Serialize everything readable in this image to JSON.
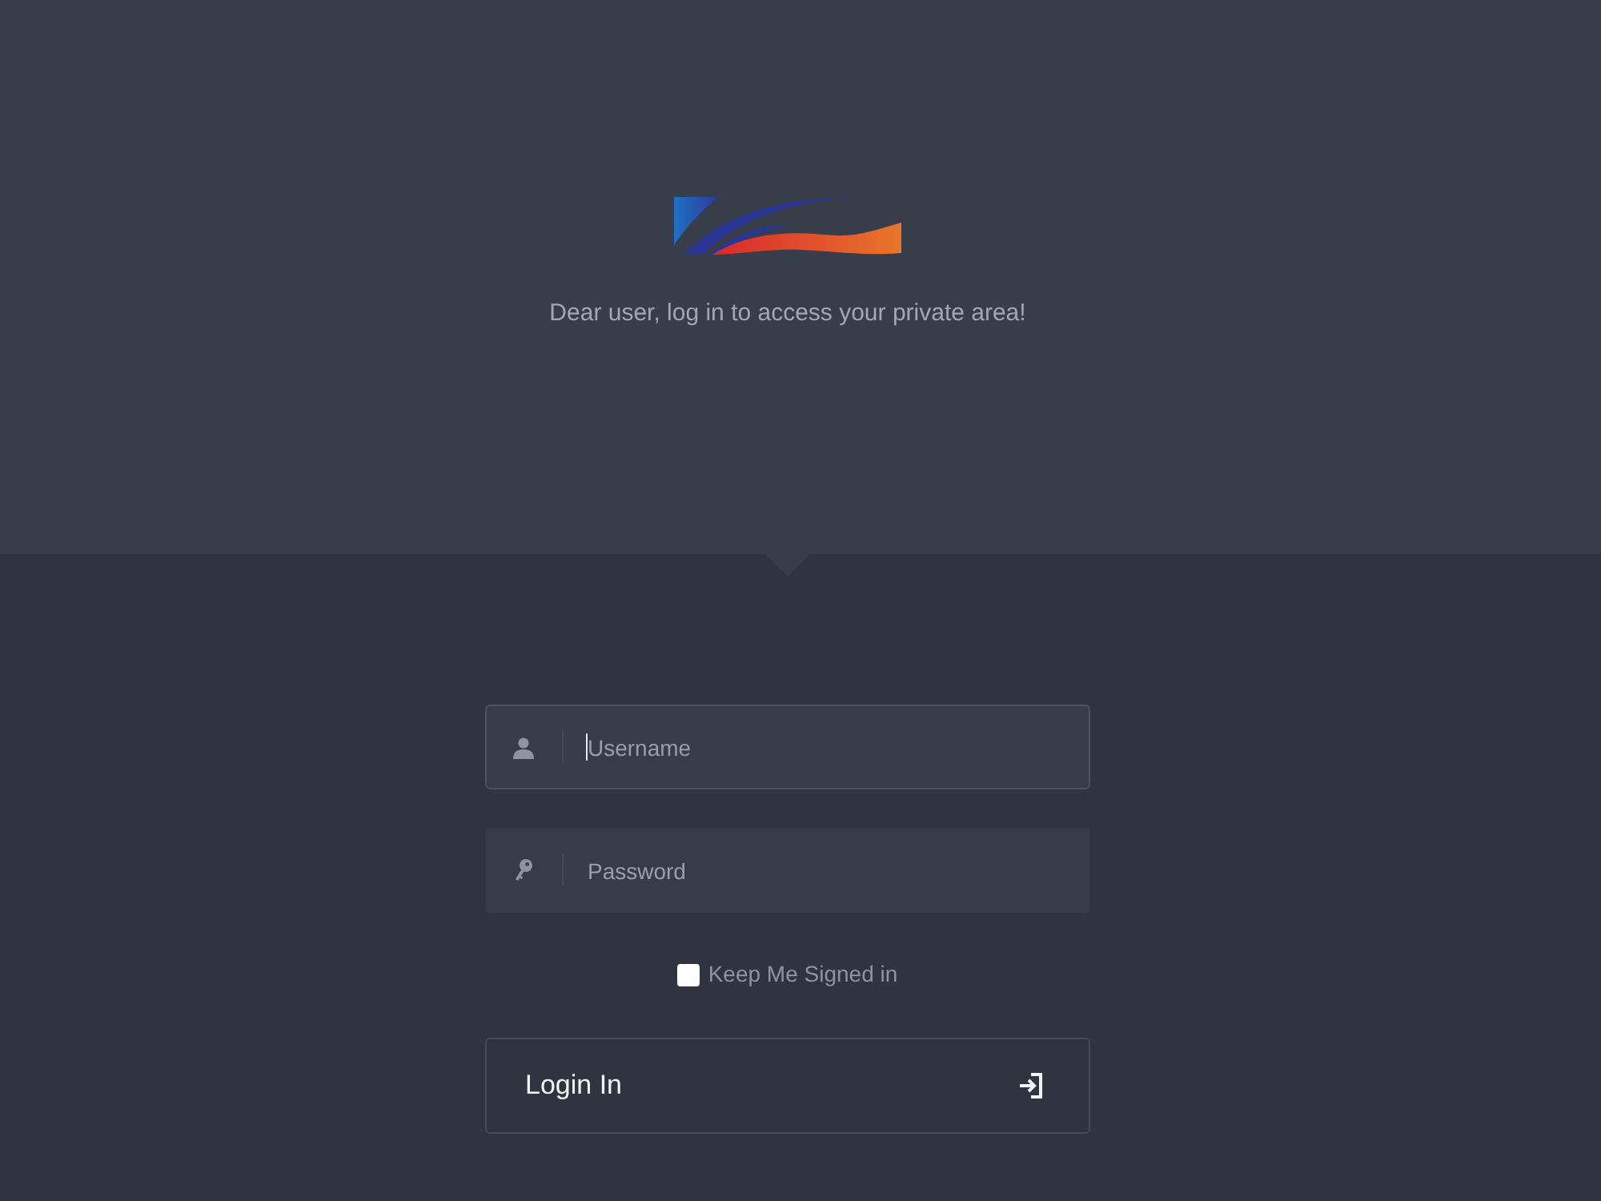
{
  "intro": {
    "message": "Dear user, log in to access your private area!"
  },
  "fields": [
    {
      "kind": "username",
      "placeholder": "Username",
      "focused": true
    },
    {
      "kind": "password",
      "placeholder": "Password",
      "focused": false
    }
  ],
  "remember": {
    "label": "Keep Me Signed in",
    "checked": false
  },
  "submit": {
    "label": "Login In"
  }
}
